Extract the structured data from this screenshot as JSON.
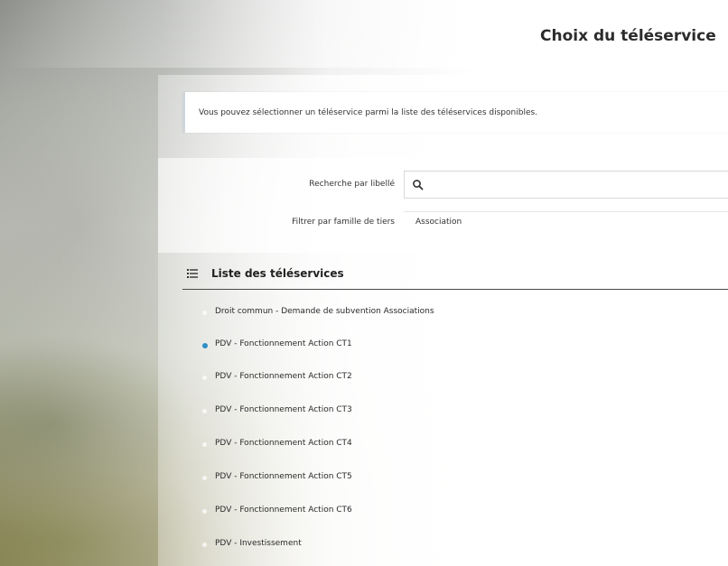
{
  "page": {
    "title": "Choix du téléservice"
  },
  "info": {
    "text": "Vous pouvez sélectionner un téléservice parmi la liste des téléservices disponibles."
  },
  "filters": {
    "search_label": "Recherche par libellé",
    "search_value": "",
    "family_label": "Filtrer par famille de tiers",
    "family_value": "Association"
  },
  "list": {
    "title": "Liste des téléservices",
    "items": [
      {
        "label": "Droit commun - Demande de subvention Associations",
        "active": false
      },
      {
        "label": "PDV - Fonctionnement Action CT1",
        "active": true
      },
      {
        "label": "PDV - Fonctionnement Action CT2",
        "active": false
      },
      {
        "label": "PDV - Fonctionnement Action CT3",
        "active": false
      },
      {
        "label": "PDV - Fonctionnement Action CT4",
        "active": false
      },
      {
        "label": "PDV - Fonctionnement Action CT5",
        "active": false
      },
      {
        "label": "PDV - Fonctionnement Action CT6",
        "active": false
      },
      {
        "label": "PDV - Investissement",
        "active": false
      }
    ]
  },
  "colors": {
    "accent": "#2d8fc3"
  }
}
